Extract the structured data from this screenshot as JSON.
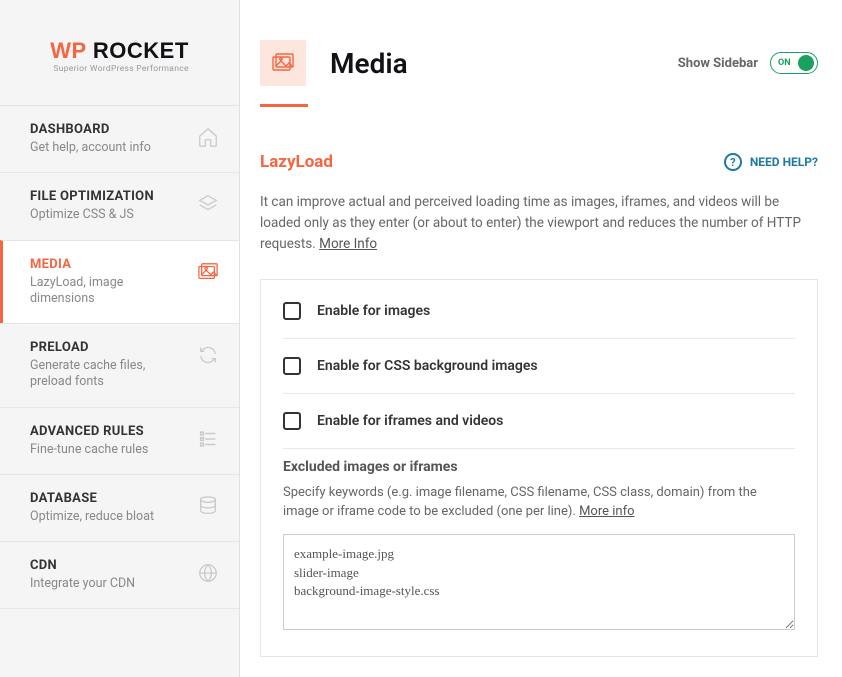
{
  "logo": {
    "brand_wp": "WP",
    "brand_rocket": " ROCKET",
    "tagline": "Superior WordPress Performance"
  },
  "sidebar": {
    "items": [
      {
        "title": "DASHBOARD",
        "desc": "Get help, account info"
      },
      {
        "title": "FILE OPTIMIZATION",
        "desc": "Optimize CSS & JS"
      },
      {
        "title": "MEDIA",
        "desc": "LazyLoad, image dimensions"
      },
      {
        "title": "PRELOAD",
        "desc": "Generate cache files, preload fonts"
      },
      {
        "title": "ADVANCED RULES",
        "desc": "Fine-tune cache rules"
      },
      {
        "title": "DATABASE",
        "desc": "Optimize, reduce bloat"
      },
      {
        "title": "CDN",
        "desc": "Integrate your CDN"
      }
    ]
  },
  "header": {
    "title": "Media",
    "show_sidebar_label": "Show Sidebar",
    "toggle_state": "ON"
  },
  "section": {
    "title": "LazyLoad",
    "need_help": "NEED HELP?",
    "description": "It can improve actual and perceived loading time as images, iframes, and videos will be loaded only as they enter (or about to enter) the viewport and reduces the number of HTTP requests. ",
    "more_info": "More Info"
  },
  "options": {
    "items": [
      "Enable for images",
      "Enable for CSS background images",
      "Enable for iframes and videos"
    ],
    "excluded": {
      "title": "Excluded images or iframes",
      "desc": "Specify keywords (e.g. image filename, CSS filename, CSS class, domain) from the image or iframe code to be excluded (one per line). ",
      "more_info": "More info",
      "value": "example-image.jpg\nslider-image\nbackground-image-style.css"
    }
  }
}
